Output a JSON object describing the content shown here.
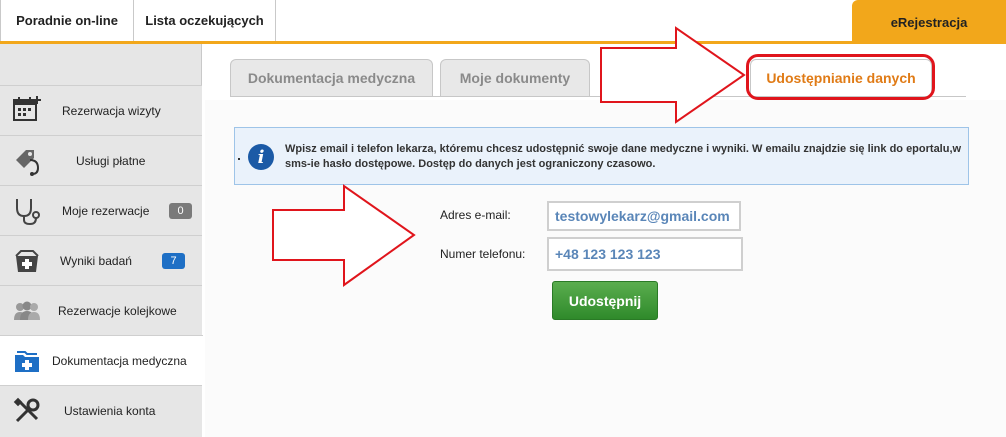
{
  "top_nav": {
    "tabs": [
      {
        "label": "Poradnie on-line"
      },
      {
        "label": "Lista oczekujących"
      }
    ],
    "ereg_label": "eRejestracja"
  },
  "sidebar": {
    "items": [
      {
        "label": "Rezerwacja wizyty",
        "icon": "calendar-add-icon"
      },
      {
        "label": "Usługi płatne",
        "icon": "price-tag-stethoscope-icon"
      },
      {
        "label": "Moje rezerwacje",
        "icon": "stethoscope-icon",
        "badge": "0"
      },
      {
        "label": "Wyniki badań",
        "icon": "medical-box-icon",
        "badge": "7"
      },
      {
        "label": "Rezerwacje kolejkowe",
        "icon": "people-queue-icon"
      },
      {
        "label": "Dokumentacja medyczna",
        "icon": "medical-folder-icon",
        "active": true
      },
      {
        "label": "Ustawienia konta",
        "icon": "tools-icon"
      }
    ]
  },
  "content": {
    "tabs": [
      {
        "label": "Dokumentacja medyczna"
      },
      {
        "label": "Moje dokumenty"
      },
      {
        "label": "Udostępnianie danych",
        "active": true
      }
    ],
    "info_text": "Wpisz email i telefon lekarza, któremu chcesz udostępnić swoje dane medyczne i wyniki. W emailu znajdzie się link do eportalu,w sms-ie hasło dostępowe. Dostęp do danych jest ograniczony czasowo.",
    "form": {
      "email_label": "Adres e-mail:",
      "email_value": "testowylekarz@gmail.com",
      "phone_label": "Numer telefonu:",
      "phone_value": "+48 123 123 123",
      "submit_label": "Udostępnij"
    }
  },
  "colors": {
    "accent": "#f2a71b",
    "active_tab_text": "#e07b16",
    "annotation_red": "#e0151c",
    "button_green": "#3d9a36",
    "info_icon": "#1b5aa6"
  }
}
